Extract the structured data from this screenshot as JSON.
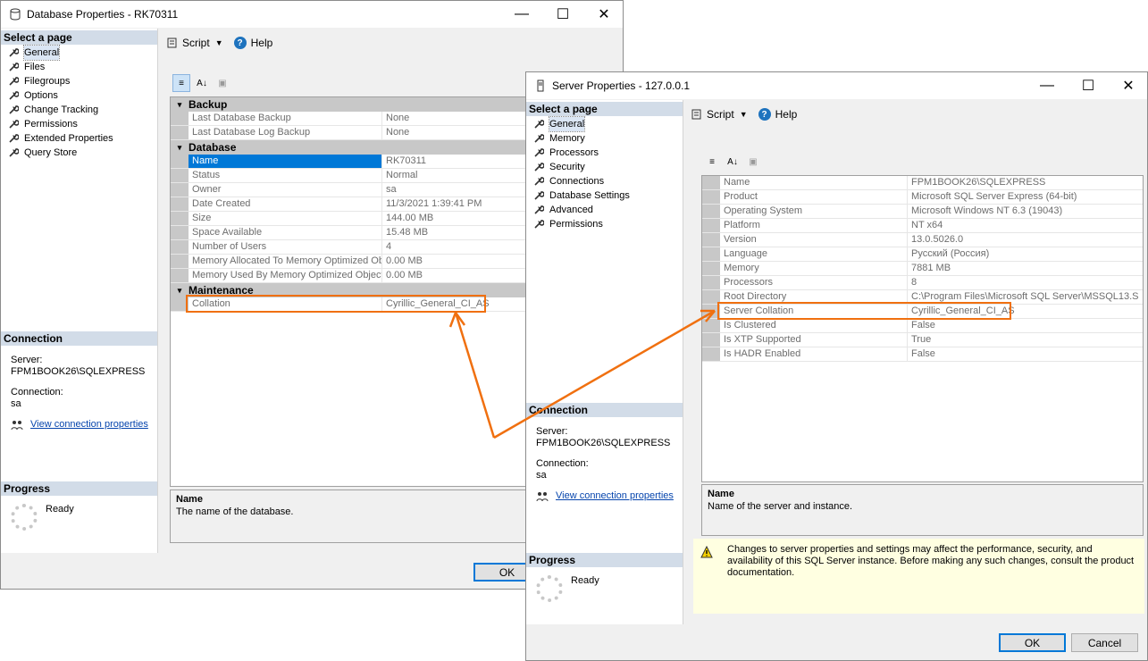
{
  "db_window": {
    "title": "Database Properties - RK70311",
    "select_page": "Select a page",
    "pages": [
      "General",
      "Files",
      "Filegroups",
      "Options",
      "Change Tracking",
      "Permissions",
      "Extended Properties",
      "Query Store"
    ],
    "script": "Script",
    "help": "Help",
    "categories": {
      "backup": "Backup",
      "database": "Database",
      "maintenance": "Maintenance"
    },
    "rows": {
      "backup": [
        {
          "name": "Last Database Backup",
          "value": "None"
        },
        {
          "name": "Last Database Log Backup",
          "value": "None"
        }
      ],
      "database": [
        {
          "name": "Name",
          "value": "RK70311"
        },
        {
          "name": "Status",
          "value": "Normal"
        },
        {
          "name": "Owner",
          "value": "sa"
        },
        {
          "name": "Date Created",
          "value": "11/3/2021 1:39:41 PM"
        },
        {
          "name": "Size",
          "value": "144.00 MB"
        },
        {
          "name": "Space Available",
          "value": "15.48 MB"
        },
        {
          "name": "Number of Users",
          "value": "4"
        },
        {
          "name": "Memory Allocated To Memory Optimized Obje",
          "value": "0.00 MB"
        },
        {
          "name": "Memory Used By Memory Optimized Objects",
          "value": "0.00 MB"
        }
      ],
      "maintenance": [
        {
          "name": "Collation",
          "value": "Cyrillic_General_CI_AS"
        }
      ]
    },
    "connection": {
      "header": "Connection",
      "server_label": "Server:",
      "server": "FPM1BOOK26\\SQLEXPRESS",
      "connection_label": "Connection:",
      "connection": "sa",
      "link": "View connection properties"
    },
    "progress": {
      "header": "Progress",
      "status": "Ready"
    },
    "desc_title": "Name",
    "desc_text": "The name of the database.",
    "ok": "OK"
  },
  "srv_window": {
    "title": "Server Properties - 127.0.0.1",
    "select_page": "Select a page",
    "pages": [
      "General",
      "Memory",
      "Processors",
      "Security",
      "Connections",
      "Database Settings",
      "Advanced",
      "Permissions"
    ],
    "script": "Script",
    "help": "Help",
    "rows": [
      {
        "name": "Name",
        "value": "FPM1BOOK26\\SQLEXPRESS"
      },
      {
        "name": "Product",
        "value": "Microsoft SQL Server Express (64-bit)"
      },
      {
        "name": "Operating System",
        "value": "Microsoft Windows NT 6.3 (19043)"
      },
      {
        "name": "Platform",
        "value": "NT x64"
      },
      {
        "name": "Version",
        "value": "13.0.5026.0"
      },
      {
        "name": "Language",
        "value": "Русский (Россия)"
      },
      {
        "name": "Memory",
        "value": "7881 MB"
      },
      {
        "name": "Processors",
        "value": "8"
      },
      {
        "name": "Root Directory",
        "value": "C:\\Program Files\\Microsoft SQL Server\\MSSQL13.S"
      },
      {
        "name": "Server Collation",
        "value": "Cyrillic_General_CI_AS"
      },
      {
        "name": "Is Clustered",
        "value": "False"
      },
      {
        "name": "Is XTP Supported",
        "value": "True"
      },
      {
        "name": "Is HADR Enabled",
        "value": "False"
      }
    ],
    "connection": {
      "header": "Connection",
      "server_label": "Server:",
      "server": "FPM1BOOK26\\SQLEXPRESS",
      "connection_label": "Connection:",
      "connection": "sa",
      "link": "View connection properties"
    },
    "progress": {
      "header": "Progress",
      "status": "Ready"
    },
    "desc_title": "Name",
    "desc_text": "Name of the server and instance.",
    "warning": "Changes to server properties and settings may affect the performance, security, and availability of this SQL Server instance. Before making any such changes, consult the product documentation.",
    "ok": "OK",
    "cancel": "Cancel"
  },
  "colors": {
    "highlight": "#f07010",
    "selection": "#0078d7",
    "section_header": "#d2dce8",
    "warning_bg": "#ffffe1"
  }
}
